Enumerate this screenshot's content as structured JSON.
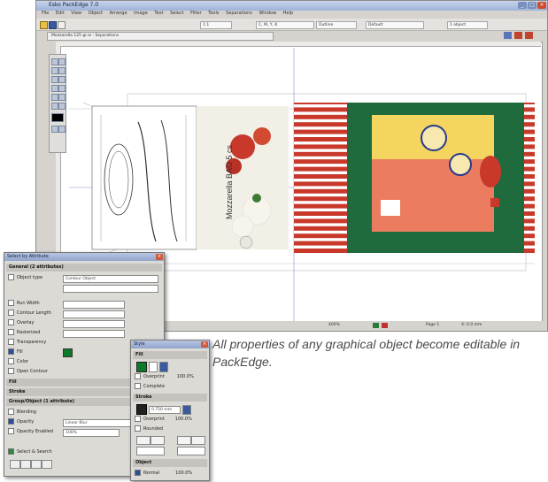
{
  "window": {
    "title": "Esko PackEdge 7.0",
    "menu": [
      "File",
      "Edit",
      "View",
      "Object",
      "Arrange",
      "Image",
      "Text",
      "Select",
      "Filter",
      "Tools",
      "Separations",
      "Window",
      "Help"
    ],
    "toolbar": {
      "zoom": "1:1",
      "color": "C, M, Y, K",
      "mode": "Outline",
      "style": "Default",
      "status": "1 object"
    },
    "doc_tab": "Mozzarella 125 gr.ai : Separations",
    "artwork_vertical_text": "Mozzarella BAG 5 cs",
    "statusbar": {
      "zoom": "400%",
      "page": "Page 1",
      "coords": "X: 0.0 mm"
    }
  },
  "dialog_select": {
    "title": "Select by Attribute",
    "section_general": "General (2 attributes)",
    "object_type_label": "Object type",
    "object_type_value": "Contour Object",
    "rows": [
      "Run Width",
      "Contour Length",
      "Overlay",
      "Rasterized",
      "Transparency",
      "Fill",
      "Color",
      "Open Contour"
    ],
    "fill_checked": true,
    "section_fill": "Fill",
    "section_stroke": "Stroke",
    "section_group": "Group/Object (1 attribute)",
    "group_rows": [
      "Blending",
      "Opacity",
      "Opacity Enabled"
    ],
    "opacity_value": "Linear Blur",
    "opacity_amount": "100%",
    "button_label": "Select & Search",
    "fill_color": "#0d7a2a"
  },
  "dialog_style": {
    "title": "Style",
    "section_fill": "Fill",
    "fill_values": [
      "Overprint",
      "100.0%",
      "Complete"
    ],
    "section_stroke": "Stroke",
    "stroke_width": "0.750 mm",
    "stroke_values": [
      "Overprint",
      "100.0%",
      "Rounded"
    ],
    "section_object": "Object",
    "object_value": "Normal",
    "object_pct": "100.0%"
  },
  "caption": "All properties of any graphical object become editable in PackEdge.",
  "colors": {
    "pack_green": "#1f6b3e",
    "accent_red": "#c8392b",
    "label_yellow": "#f3d24c"
  }
}
